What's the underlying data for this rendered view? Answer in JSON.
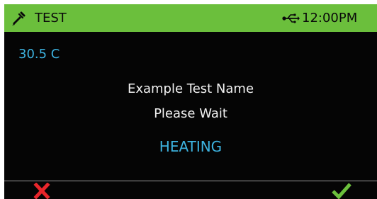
{
  "status_bar": {
    "app_icon": "test-tube-icon",
    "app_title": "TEST",
    "connection_icon": "usb-icon",
    "clock": "12:00PM",
    "background_color": "#6bbf3c"
  },
  "main": {
    "temperature": "30.5 C",
    "test_name": "Example Test Name",
    "status_message": "Please Wait",
    "state": "HEATING",
    "accent_color": "#3db3e0"
  },
  "footer": {
    "cancel_icon": "close-icon",
    "cancel_color": "#e8262b",
    "confirm_icon": "check-icon",
    "confirm_color": "#6bbf3c"
  }
}
